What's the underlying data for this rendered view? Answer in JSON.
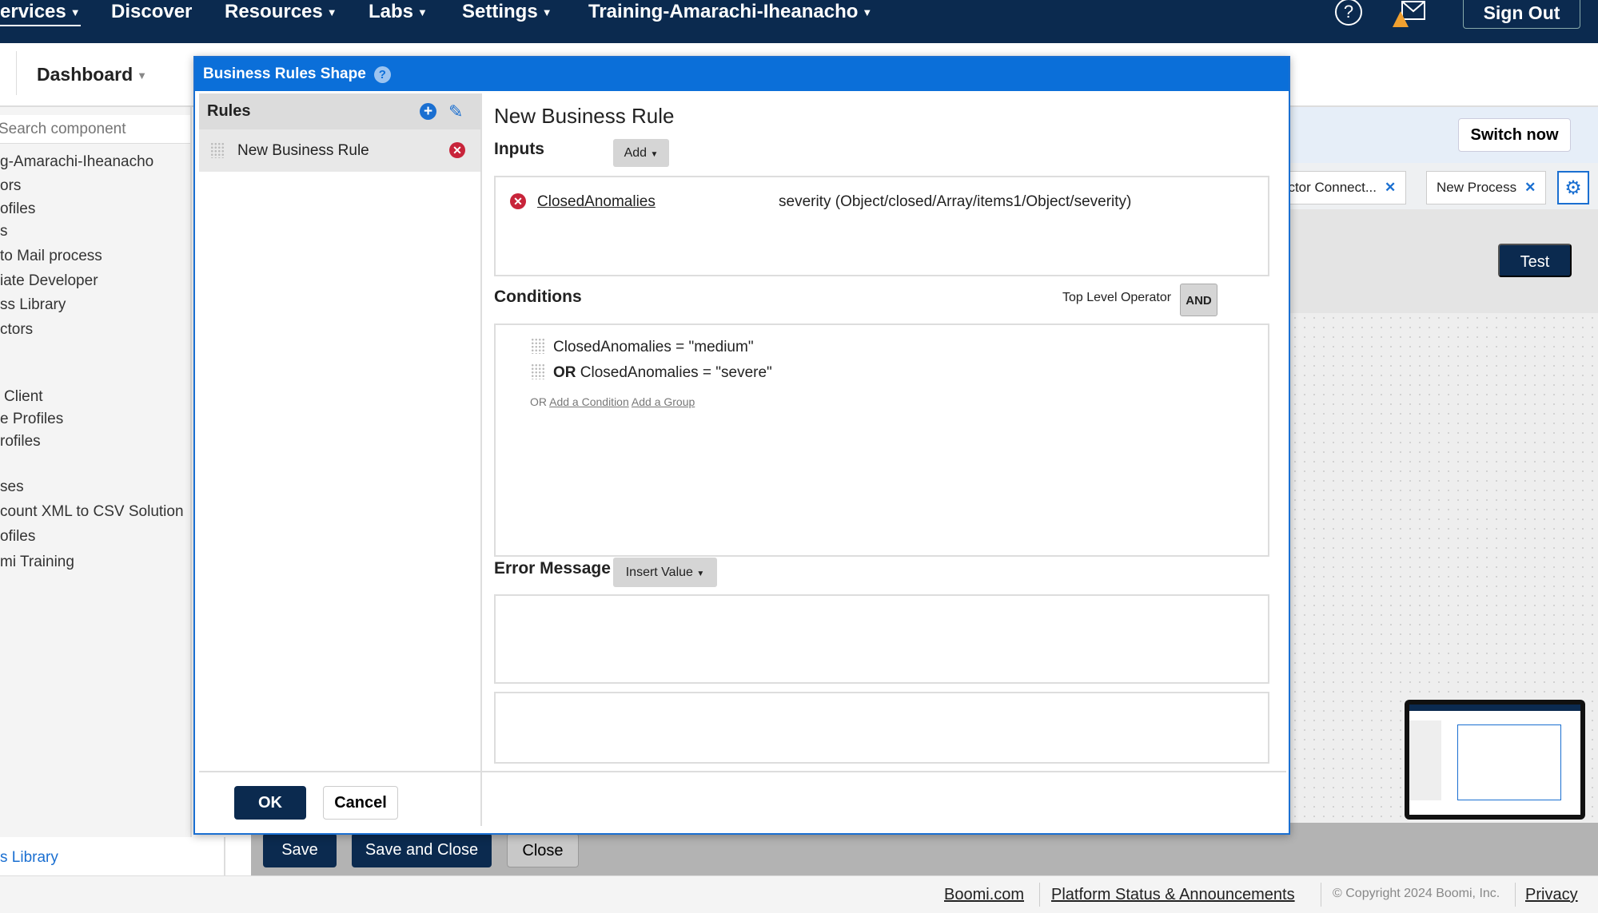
{
  "topnav": {
    "items": [
      "ervices",
      "Discover",
      "Resources",
      "Labs",
      "Settings",
      "Training-Amarachi-Iheanacho"
    ],
    "sign_out": "Sign Out"
  },
  "subheader": {
    "dashboard": "Dashboard"
  },
  "sidebar": {
    "search_placeholder": "Search component",
    "items": [
      "g-Amarachi-Iheanacho",
      "ors",
      "ofiles",
      "s",
      "to Mail process",
      "iate Developer",
      "ss Library",
      "ctors",
      "Client",
      "e Profiles",
      "rofiles",
      "ses",
      "count XML to CSV Solution",
      "ofiles",
      "mi Training"
    ],
    "bottom_link": "s Library"
  },
  "background": {
    "switch_now": "Switch now",
    "tabs": [
      {
        "label": "ector Connect..."
      },
      {
        "label": "New Process"
      }
    ],
    "test": "Test",
    "save": "Save",
    "save_and_close": "Save and Close",
    "close": "Close"
  },
  "dialog": {
    "title": "Business Rules Shape",
    "rules_header": "Rules",
    "rule_items": [
      "New Business Rule"
    ],
    "rule_title": "New Business Rule",
    "inputs_label": "Inputs",
    "add_label": "Add",
    "inputs": [
      {
        "name": "ClosedAnomalies",
        "path": "severity (Object/closed/Array/items1/Object/severity)"
      }
    ],
    "conditions_label": "Conditions",
    "top_level_operator_label": "Top Level Operator",
    "top_level_operator": "AND",
    "conditions": [
      {
        "op": "",
        "text": "ClosedAnomalies = \"medium\""
      },
      {
        "op": "OR",
        "text": "ClosedAnomalies = \"severe\""
      }
    ],
    "add_prefix": "OR",
    "add_condition": "Add a Condition",
    "add_group": "Add a Group",
    "error_message_label": "Error Message",
    "insert_value": "Insert Value",
    "ok": "OK",
    "cancel": "Cancel"
  },
  "footer": {
    "links": [
      "Boomi.com",
      "Platform Status & Announcements"
    ],
    "copyright": "© Copyright 2024 Boomi, Inc.",
    "privacy": "Privacy"
  },
  "colors": {
    "nav": "#0b2a4f",
    "dialog_title": "#0b6fd9",
    "error": "#c8243a"
  }
}
